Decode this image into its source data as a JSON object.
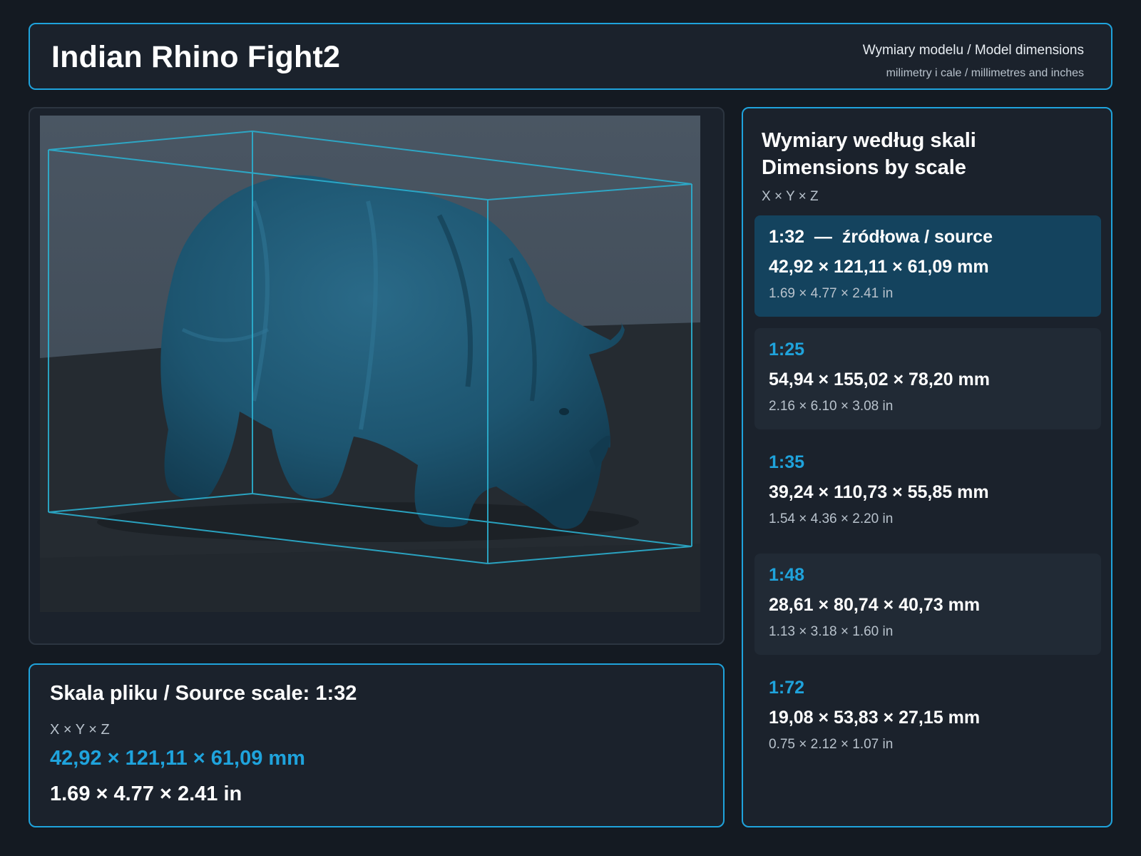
{
  "header": {
    "title": "Indian Rhino Fight2",
    "subtitle": "Wymiary modelu / Model dimensions",
    "units_note": "milimetry i cale / millimetres and inches"
  },
  "source": {
    "title": "Skala pliku / Source scale: 1:32",
    "axes": "X × Y × Z",
    "mm": "42,92 × 121,11 × 61,09 mm",
    "inches": "1.69 × 4.77 × 2.41 in"
  },
  "scales": {
    "title_pl": "Wymiary według skali",
    "title_en": "Dimensions by scale",
    "axes": "X × Y × Z",
    "rows": [
      {
        "label": "1:32  —  źródłowa / source",
        "mm": "42,92 × 121,11 × 61,09 mm",
        "inches": "1.69 × 4.77 × 2.41 in",
        "active": true
      },
      {
        "label": "1:25",
        "mm": "54,94 × 155,02 × 78,20 mm",
        "inches": "2.16 × 6.10 × 3.08 in"
      },
      {
        "label": "1:35",
        "mm": "39,24 × 110,73 × 55,85 mm",
        "inches": "1.54 × 4.36 × 2.20 in"
      },
      {
        "label": "1:48",
        "mm": "28,61 × 80,74 × 40,73 mm",
        "inches": "1.13 × 3.18 × 1.60 in"
      },
      {
        "label": "1:72",
        "mm": "19,08 × 53,83 × 27,15 mm",
        "inches": "0.75 × 2.12 × 1.07 in"
      }
    ]
  },
  "colors": {
    "accent": "#1fa3dc",
    "background": "#141a22",
    "panel": "#1b222c",
    "active_row": "#14435e",
    "model": "#1d5570"
  }
}
